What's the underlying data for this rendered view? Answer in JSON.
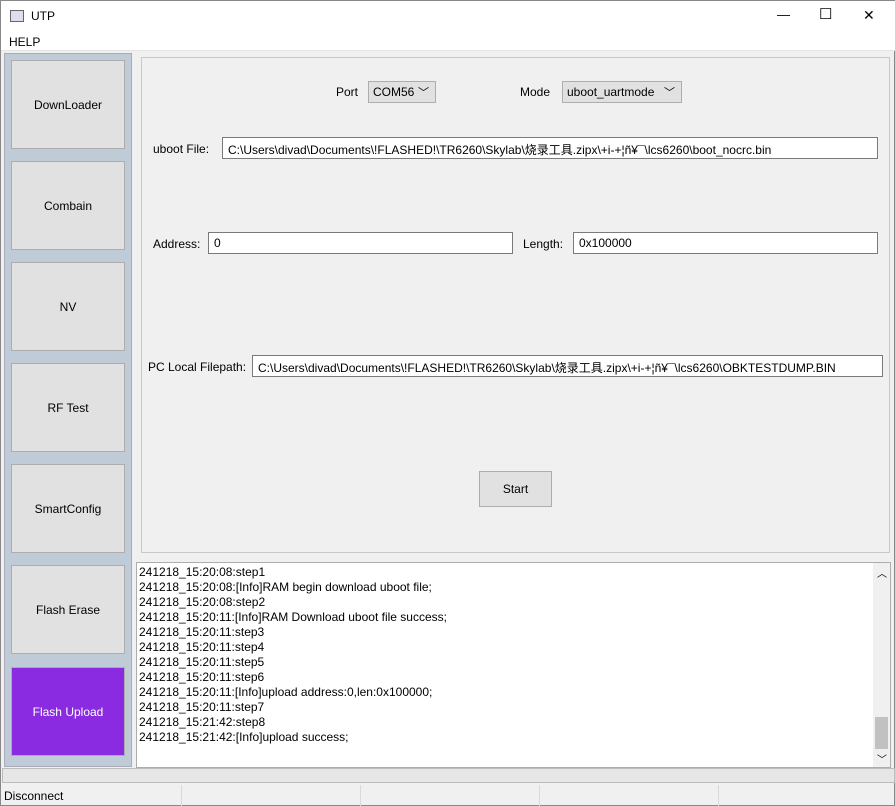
{
  "window": {
    "title": "UTP",
    "minimize": "—",
    "maximize": "☐",
    "close": "✕"
  },
  "menu": {
    "help": "HELP"
  },
  "sidebar": {
    "items": [
      {
        "label": "DownLoader"
      },
      {
        "label": "Combain"
      },
      {
        "label": "NV"
      },
      {
        "label": "RF Test"
      },
      {
        "label": "SmartConfig"
      },
      {
        "label": "Flash Erase"
      },
      {
        "label": "Flash Upload",
        "active": true
      }
    ]
  },
  "form": {
    "port_label": "Port",
    "port_value": "COM56",
    "mode_label": "Mode",
    "mode_value": "uboot_uartmode",
    "uboot_label": "uboot File:",
    "uboot_value": "C:\\Users\\divad\\Documents\\!FLASHED!\\TR6260\\Skylab\\烧录工具.zipx\\+i-+¦ñ¥¯\\lcs6260\\boot_nocrc.bin",
    "address_label": "Address:",
    "address_value": "0",
    "length_label": "Length:",
    "length_value": "0x100000",
    "local_label": "PC Local Filepath:",
    "local_value": "C:\\Users\\divad\\Documents\\!FLASHED!\\TR6260\\Skylab\\烧录工具.zipx\\+i-+¦ñ¥¯\\lcs6260\\OBKTESTDUMP.BIN",
    "start_label": "Start"
  },
  "log": [
    "241218_15:20:08:step1",
    "241218_15:20:08:[Info]RAM begin download uboot file;",
    "241218_15:20:08:step2",
    "241218_15:20:11:[Info]RAM Download uboot file success;",
    "241218_15:20:11:step3",
    "241218_15:20:11:step4",
    "241218_15:20:11:step5",
    "241218_15:20:11:step6",
    "241218_15:20:11:[Info]upload address:0,len:0x100000;",
    "241218_15:20:11:step7",
    "241218_15:21:42:step8",
    "241218_15:21:42:[Info]upload success;"
  ],
  "status": {
    "connection": "Disconnect"
  },
  "colors": {
    "active": "#8a2be2",
    "sidebar": "#c0cbd8"
  }
}
